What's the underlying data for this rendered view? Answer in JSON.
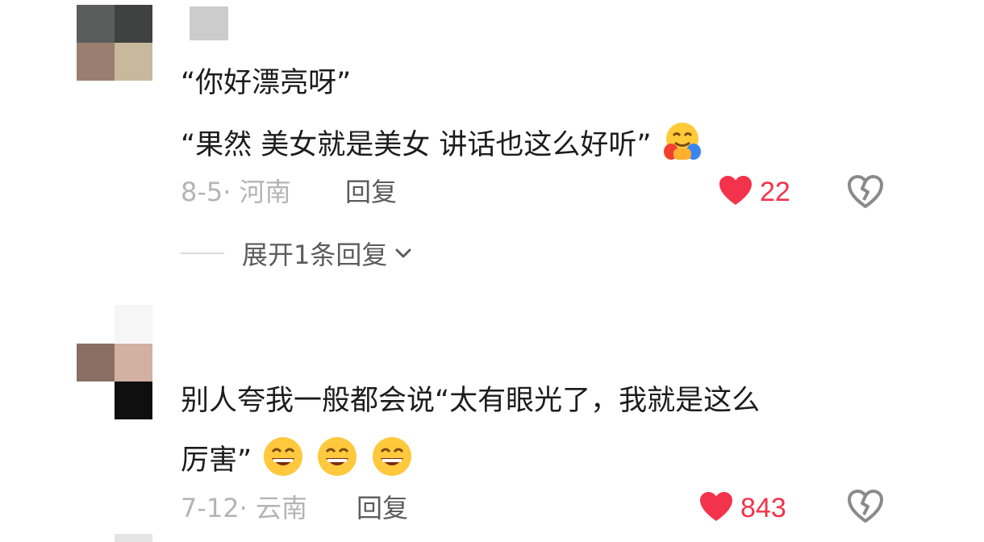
{
  "comments": [
    {
      "lines": [
        "“你好漂亮呀”",
        "“果然 美女就是美女 讲话也这么好听”"
      ],
      "date_location": "8-5· 河南",
      "reply_label": "回复",
      "likes": "22",
      "liked": true,
      "trailing_emoji": "hugging-face"
    },
    {
      "lines": [
        "别人夸我一般都会说“太有眼光了，我就是这么",
        "厉害”"
      ],
      "date_location": "7-12· 云南",
      "reply_label": "回复",
      "likes": "843",
      "liked": true,
      "trailing_emoji": "grinning-face-x3"
    }
  ],
  "expand_replies": {
    "label": "展开1条回复"
  },
  "colors": {
    "like_red": "#f3334b",
    "meta_gray": "#b4b4b4",
    "text_dark": "#1c1c1c",
    "reply_gray": "#5c5c5c"
  },
  "icons": {
    "like": "heart-filled-icon",
    "dislike": "broken-heart-icon",
    "expand": "chevron-down-icon"
  }
}
